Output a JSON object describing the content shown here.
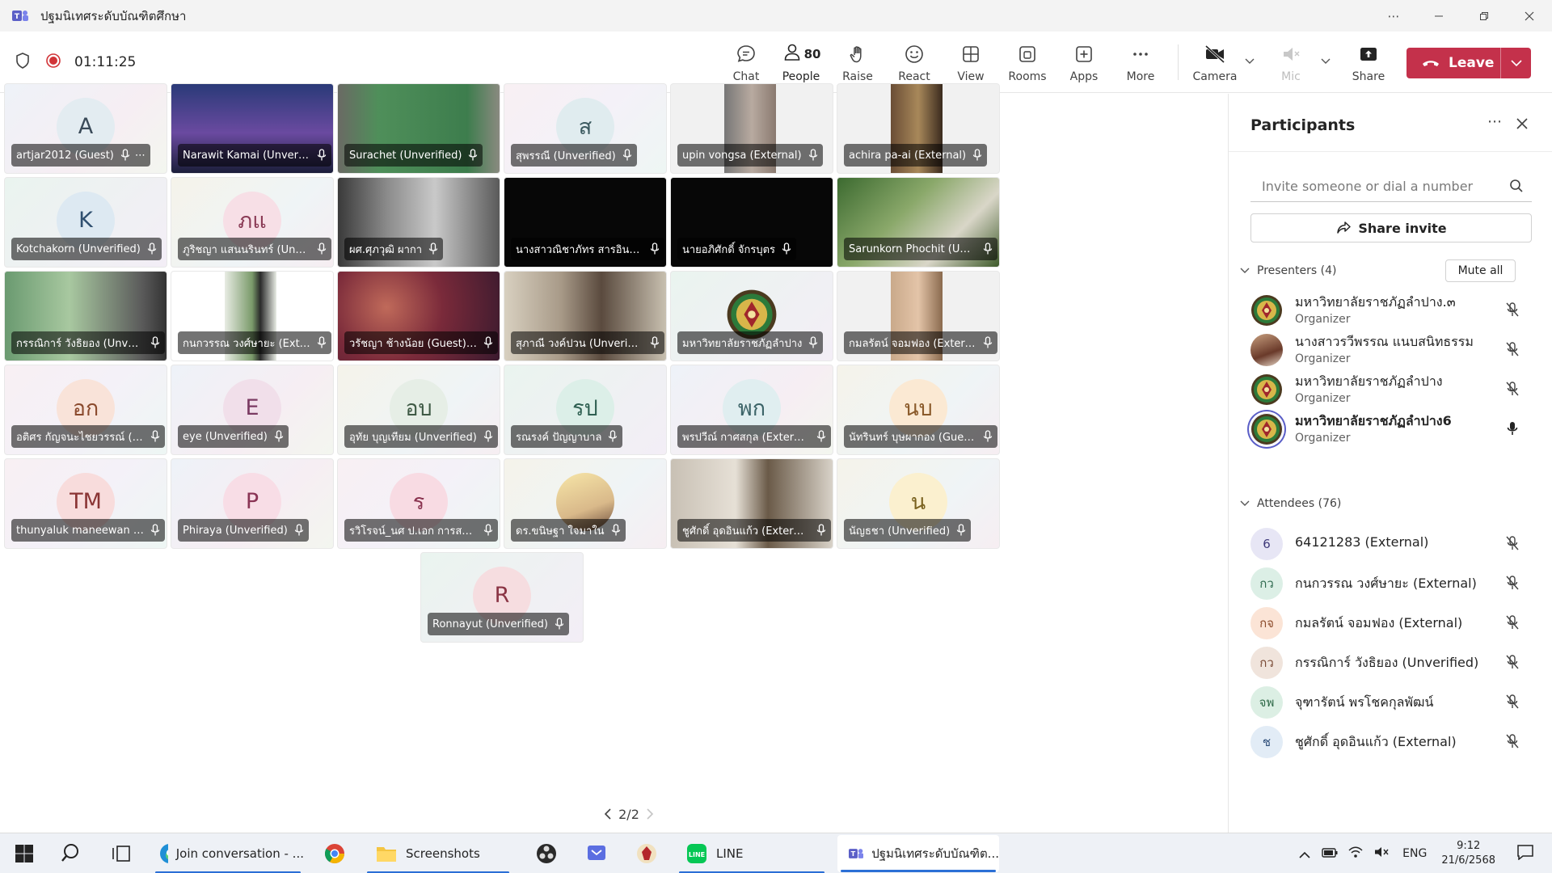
{
  "window": {
    "title": "ปฐมนิเทศระดับบัณฑิตศึกษา"
  },
  "meeting": {
    "timer": "01:11:25",
    "people_count": "80",
    "toolbar": {
      "chat": "Chat",
      "people": "People",
      "raise": "Raise",
      "react": "React",
      "view": "View",
      "rooms": "Rooms",
      "apps": "Apps",
      "more": "More",
      "camera": "Camera",
      "mic": "Mic",
      "share": "Share",
      "leave": "Leave"
    }
  },
  "tiles": [
    {
      "name": "artjar2012 (Guest)",
      "initials": "A",
      "bg": "bg-soft-a",
      "av": "#e3ecf1",
      "fg": "#3a4a58",
      "more": "⋯"
    },
    {
      "name": "Narawit Kamai (Unverifi...",
      "video": "night"
    },
    {
      "name": "Surachet (Unverified)",
      "video": "room-green"
    },
    {
      "name": "สุพรรณี (Unverified)",
      "initials": "ส",
      "bg": "bg-soft-b",
      "av": "#e0ecef",
      "fg": "#3c5a60"
    },
    {
      "name": "upin vongsa (External)",
      "video": "portrait-strip"
    },
    {
      "name": "achira pa-ai (External)",
      "video": "portrait-strip2"
    },
    {
      "name": "Kotchakorn (Unverified)",
      "initials": "K",
      "bg": "bg-soft-d",
      "av": "#dde9f2",
      "fg": "#2f4f6f"
    },
    {
      "name": "ภูริชญา แสนนรินทร์ (Unve...",
      "initials": "ภแ",
      "bg": "bg-soft-c",
      "av": "#f7dfe6",
      "fg": "#8a3a55"
    },
    {
      "name": "ผศ.ศุภวุฒิ ผากา",
      "video": "office"
    },
    {
      "name": "นางสาวณิชาภัทร สารอินท...",
      "video": "dark"
    },
    {
      "name": "นายอภิศักดิ์ จักรบุตร",
      "video": "dark"
    },
    {
      "name": "Sarunkorn Phochit (Unv...",
      "video": "garden"
    },
    {
      "name": "กรรณิการ์ วังธิยอง (Unveri...",
      "video": "kitchen"
    },
    {
      "name": "กนกวรรณ วงศ์ษายะ (Exte...",
      "video": "portrait-white"
    },
    {
      "name": "วรัชญา ช้างน้อย (Guest) (...",
      "video": "blur-red"
    },
    {
      "name": "สุภาณี วงค์ปวน (Unverified)",
      "video": "woman"
    },
    {
      "name": "มหาวิทยาลัยราชภัฏลำปาง",
      "logo": true,
      "bg": "bg-soft-d"
    },
    {
      "name": "กมลรัตน์ จอมฟอง (Extern...",
      "video": "portrait-strip3"
    },
    {
      "name": "อติศร กัญจนะไชยวรรณ์ (E...",
      "initials": "อก",
      "bg": "bg-soft-b",
      "av": "#f9e3d9",
      "fg": "#8b4a2d"
    },
    {
      "name": "eye (Unverified)",
      "initials": "E",
      "bg": "bg-soft-a",
      "av": "#f1dfea",
      "fg": "#7a3a62"
    },
    {
      "name": "อุทัย บุญเทียม (Unverified)",
      "initials": "อบ",
      "bg": "bg-soft-c",
      "av": "#e6eee6",
      "fg": "#3f5a45"
    },
    {
      "name": "รณรงค์ ปัญญาบาล",
      "initials": "รป",
      "bg": "bg-soft-d",
      "av": "#dcefe8",
      "fg": "#2f6052"
    },
    {
      "name": "พรปวีณ์ กาศสกุล (External)",
      "initials": "พก",
      "bg": "bg-soft-a",
      "av": "#e0eef0",
      "fg": "#3c6468"
    },
    {
      "name": "นัทรินทร์ บุษผากอง (Guest)",
      "initials": "นบ",
      "bg": "bg-soft-c",
      "av": "#fbe9d3",
      "fg": "#8a5a2a"
    },
    {
      "name": "thunyaluk maneewan (E...",
      "initials": "TM",
      "bg": "bg-soft-b",
      "av": "#f8dcdc",
      "fg": "#8a3434"
    },
    {
      "name": "Phiraya (Unverified)",
      "initials": "P",
      "bg": "bg-soft-a",
      "av": "#f8dde6",
      "fg": "#8a3455"
    },
    {
      "name": "รวิโรจน์_นศ ป.เอก การสอน...",
      "initials": "ร",
      "bg": "bg-soft-b",
      "av": "#f8dbe3",
      "fg": "#8a3450"
    },
    {
      "name": "ดร.ขนิษฐา ใจมาใน",
      "photo": true,
      "bg": "bg-soft-c"
    },
    {
      "name": "ชูศักดิ์ อุดอินแก้ว (External)",
      "video": "headset"
    },
    {
      "name": "นัญธชา (Unverified)",
      "initials": "น",
      "bg": "bg-soft-c",
      "av": "#fbf0cf",
      "fg": "#7a6220"
    },
    {
      "name": "Ronnayut (Unverified)",
      "initials": "R",
      "bg": "bg-soft-d",
      "av": "#f6dde0",
      "fg": "#8a3444"
    }
  ],
  "pager": {
    "label": "2/2"
  },
  "panel": {
    "title": "Participants",
    "invite_placeholder": "Invite someone or dial a number",
    "share_invite": "Share invite",
    "presenters_header": "Presenters (4)",
    "mute_all": "Mute all",
    "attendees_header": "Attendees (76)",
    "presenters": [
      {
        "name": "มหาวิทยาลัยราชภัฏลำปาง.๓",
        "role": "Organizer",
        "avatar": "logo"
      },
      {
        "name": "นางสาวรวีพรรณ แนบสนิทธรรม",
        "role": "Organizer",
        "avatar": "photo"
      },
      {
        "name": "มหาวิทยาลัยราชภัฏลำปาง",
        "role": "Organizer",
        "avatar": "logo"
      },
      {
        "name": "มหาวิทยาลัยราชภัฏลำปาง6",
        "role": "Organizer",
        "avatar": "logo",
        "speaking": true
      }
    ],
    "attendees": [
      {
        "name": "64121283 (External)",
        "initials": "6",
        "av": "#e7e6f5",
        "fg": "#3f3a7a"
      },
      {
        "name": "กนกวรรณ วงศ์ษายะ (External)",
        "initials": "กว",
        "av": "#dcefe6",
        "fg": "#2f6a4f"
      },
      {
        "name": "กมลรัตน์ จอมฟอง (External)",
        "initials": "กจ",
        "av": "#fbe4d6",
        "fg": "#8b4a2a"
      },
      {
        "name": "กรรณิการ์ วังธิยอง (Unverified)",
        "initials": "กว",
        "av": "#f0e4dc",
        "fg": "#7a4a35"
      },
      {
        "name": "จุฑารัตน์ พรโชคกุลพัฒน์",
        "initials": "จพ",
        "av": "#dcefe4",
        "fg": "#2f6a48"
      },
      {
        "name": "ชูศักดิ์ อุดอินแก้ว (External)",
        "initials": "ช",
        "av": "#e2ecf6",
        "fg": "#2f4f7a"
      }
    ]
  },
  "taskbar": {
    "edge_label": "Join conversation - ...",
    "explorer_label": "Screenshots",
    "line_label": "LINE",
    "teams_label": "ปฐมนิเทศระดับบัณฑิต...",
    "lang": "ENG",
    "time": "9:12",
    "date": "21/6/2568"
  },
  "colors": {
    "accent": "#5b5fc7",
    "leave": "#c4314b",
    "record": "#d13438"
  }
}
